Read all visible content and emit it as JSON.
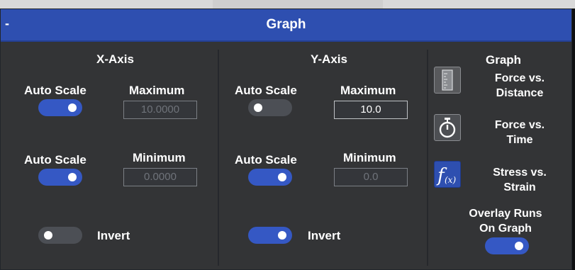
{
  "window": {
    "title": "Graph",
    "collapse_symbol": "-"
  },
  "x_axis": {
    "heading": "X-Axis",
    "max_auto_scale_label": "Auto Scale",
    "max_auto_scale_on": true,
    "maximum_label": "Maximum",
    "maximum_value": "10.0000",
    "min_auto_scale_label": "Auto Scale",
    "min_auto_scale_on": true,
    "minimum_label": "Minimum",
    "minimum_value": "0.0000",
    "invert_label": "Invert",
    "invert_on": false
  },
  "y_axis": {
    "heading": "Y-Axis",
    "max_auto_scale_label": "Auto Scale",
    "max_auto_scale_on": false,
    "maximum_label": "Maximum",
    "maximum_value": "10.0",
    "min_auto_scale_label": "Auto Scale",
    "min_auto_scale_on": true,
    "minimum_label": "Minimum",
    "minimum_value": "0.0",
    "invert_label": "Invert",
    "invert_on": true
  },
  "graph": {
    "heading": "Graph",
    "options": [
      {
        "line1": "Force vs.",
        "line2": "Distance",
        "icon": "ruler-icon"
      },
      {
        "line1": "Force vs.",
        "line2": "Time",
        "icon": "stopwatch-icon"
      },
      {
        "line1": "Stress vs.",
        "line2": "Strain",
        "icon": "fx-icon",
        "selected": true
      }
    ],
    "overlay_line1": "Overlay Runs",
    "overlay_line2": "On Graph",
    "overlay_on": true
  },
  "colors": {
    "accent": "#2e4fb0",
    "toggle_on": "#3558c4",
    "toggle_off": "#4c4f55",
    "panel_bg": "#333436"
  }
}
